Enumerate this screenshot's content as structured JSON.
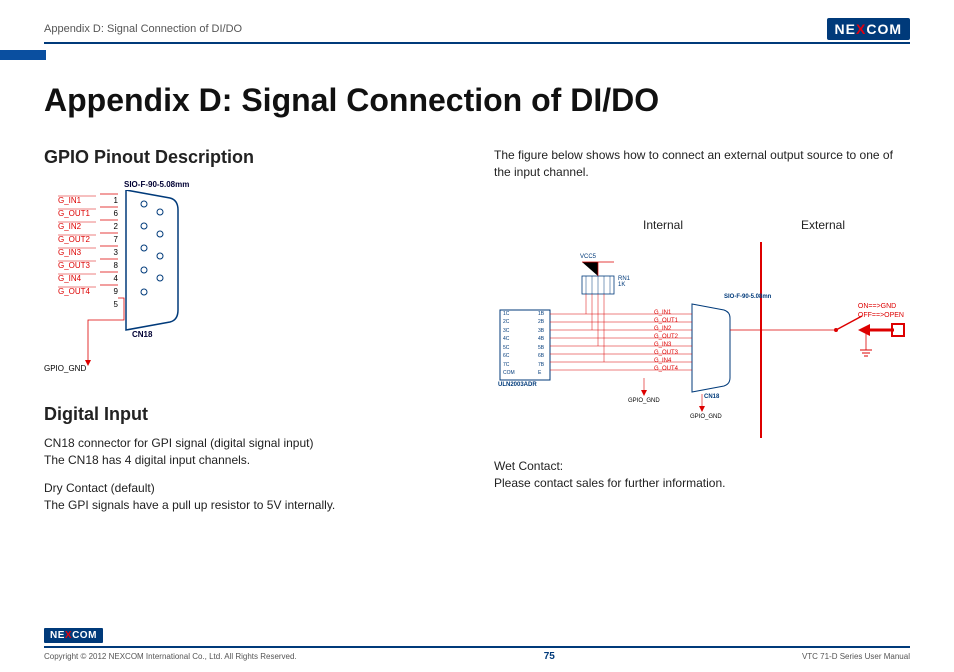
{
  "header": {
    "breadcrumb": "Appendix D: Signal Connection of DI/DO",
    "logo": "NEXCOM"
  },
  "title": "Appendix D: Signal Connection of DI/DO",
  "left": {
    "section1_title": "GPIO Pinout Description",
    "connector_model": "SIO-F-90-5.08mm",
    "pins": [
      {
        "name": "G_IN1",
        "num": "1"
      },
      {
        "name": "G_OUT1",
        "num": "6"
      },
      {
        "name": "G_IN2",
        "num": "2"
      },
      {
        "name": "G_OUT2",
        "num": "7"
      },
      {
        "name": "G_IN3",
        "num": "3"
      },
      {
        "name": "G_OUT3",
        "num": "8"
      },
      {
        "name": "G_IN4",
        "num": "4"
      },
      {
        "name": "G_OUT4",
        "num": "9"
      },
      {
        "name": "",
        "num": "5"
      }
    ],
    "connector_id": "CN18",
    "gpio_gnd": "GPIO_GND",
    "section2_title": "Digital Input",
    "di_line1": "CN18 connector for GPI signal (digital signal input)",
    "di_line2": "The CN18 has 4 digital input channels.",
    "di_line3": "Dry Contact (default)",
    "di_line4": "The GPI signals have a pull up resistor to 5V internally."
  },
  "right": {
    "intro": "The figure below shows how to connect an external output source to one of the input channel.",
    "col_internal": "Internal",
    "col_external": "External",
    "schematic": {
      "vcc": "VCC5",
      "rn": "RN1\n1K",
      "ic": "ULN2003ADR",
      "connector_model": "SIO-F-90-5.08mn",
      "connector_id": "CN18",
      "gpio_gnd": "GPIO_GND",
      "pins_red": [
        "G_IN1",
        "G_OUT1",
        "G_IN2",
        "G_OUT2",
        "G_IN3",
        "G_OUT3",
        "G_IN4",
        "G_OUT4"
      ],
      "ic_left_labels": [
        "1C",
        "2C",
        "3C",
        "4C",
        "5C",
        "6C",
        "7C",
        "COM"
      ],
      "ic_right_labels": [
        "1B",
        "2B",
        "3B",
        "4B",
        "5B",
        "6B",
        "7B",
        "E"
      ],
      "sw_on": "ON==>GND",
      "sw_off": "OFF==>OPEN"
    },
    "wet_line1": "Wet Contact:",
    "wet_line2": "Please contact sales for further information."
  },
  "footer": {
    "copyright": "Copyright © 2012 NEXCOM International Co., Ltd. All Rights Reserved.",
    "page": "75",
    "manual": "VTC 71-D Series User Manual",
    "logo": "NEXCOM"
  }
}
